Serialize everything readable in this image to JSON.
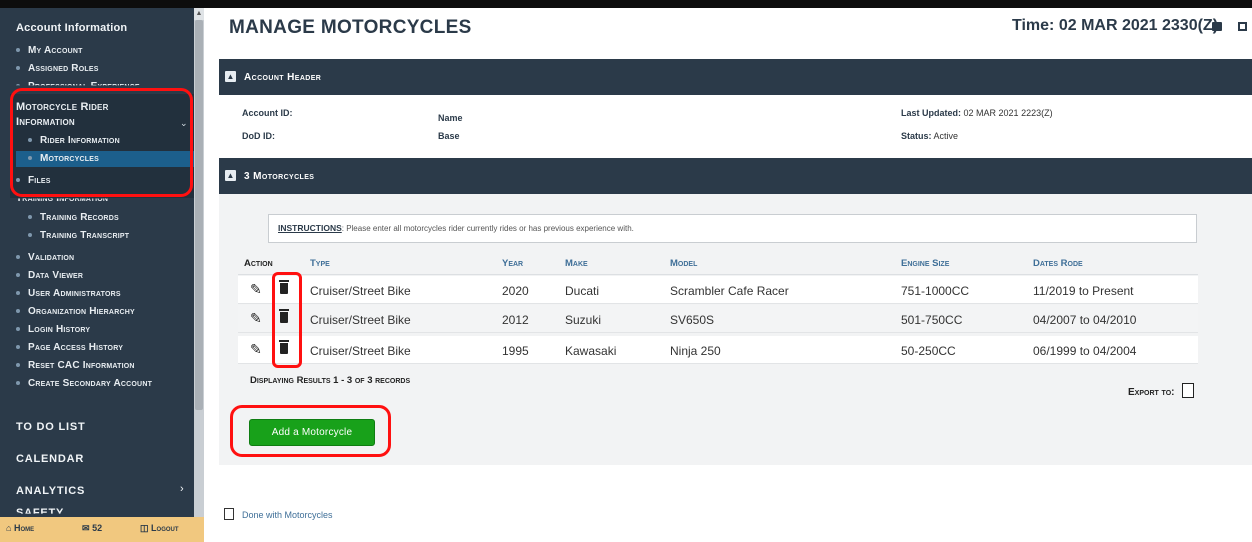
{
  "sidebar": {
    "title": "Account Information",
    "items_top": [
      "My Account",
      "Assigned Roles",
      "Professional Experience"
    ],
    "group_title_line1": "Motorcycle Rider",
    "group_title_line2": "Information",
    "group_items": [
      "Rider Information",
      "Motorcycles"
    ],
    "files": "Files",
    "training_title": "Training Information",
    "training_items": [
      "Training Records",
      "Training Transcript"
    ],
    "items_bottom": [
      "Validation",
      "Data Viewer",
      "User Administrators",
      "Organization Hierarchy",
      "Login History",
      "Page Access History",
      "Reset CAC Information",
      "Create Secondary Account"
    ],
    "sections": [
      "TO DO LIST",
      "CALENDAR",
      "ANALYTICS",
      "SAFETY"
    ],
    "footer": {
      "home": "Home",
      "mail_count": "52",
      "logout": "Logout"
    }
  },
  "header": {
    "title": "MANAGE MOTORCYCLES",
    "time": "Time: 02 MAR 2021 2330(Z)"
  },
  "account_panel": {
    "header": "Account Header",
    "account_id_label": "Account ID:",
    "name_label": "Name",
    "dod_id_label": "DoD ID:",
    "base_label": "Base",
    "last_updated_label": "Last Updated:",
    "last_updated_value": "02 MAR 2021 2223(Z)",
    "status_label": "Status:",
    "status_value": "Active"
  },
  "motorcycles_panel": {
    "header": "3 Motorcycles",
    "instructions_label": "INSTRUCTIONS",
    "instructions_text": ": Please enter all motorcycles rider currently rides or has previous experience with.",
    "columns": [
      "Action",
      "Type",
      "Year",
      "Make",
      "Model",
      "Engine Size",
      "Dates Rode"
    ],
    "rows": [
      {
        "type": "Cruiser/Street Bike",
        "year": "2020",
        "make": "Ducati",
        "model": "Scrambler Cafe Racer",
        "engine": "751-1000CC",
        "dates": "11/2019 to Present"
      },
      {
        "type": "Cruiser/Street Bike",
        "year": "2012",
        "make": "Suzuki",
        "model": "SV650S",
        "engine": "501-750CC",
        "dates": "04/2007 to 04/2010"
      },
      {
        "type": "Cruiser/Street Bike",
        "year": "1995",
        "make": "Kawasaki",
        "model": "Ninja 250",
        "engine": "50-250CC",
        "dates": "06/1999 to 04/2004"
      }
    ],
    "displaying": "Displaying Results 1 - 3 of 3 records",
    "export_label": "Export to:",
    "add_button": "Add a Motorcycle"
  },
  "done_link": "Done with Motorcycles",
  "colors": {
    "sidebar_bg": "#2b3a49",
    "active": "#1c5f8c",
    "button_green": "#18a11a",
    "highlight_red": "#ff1010"
  }
}
